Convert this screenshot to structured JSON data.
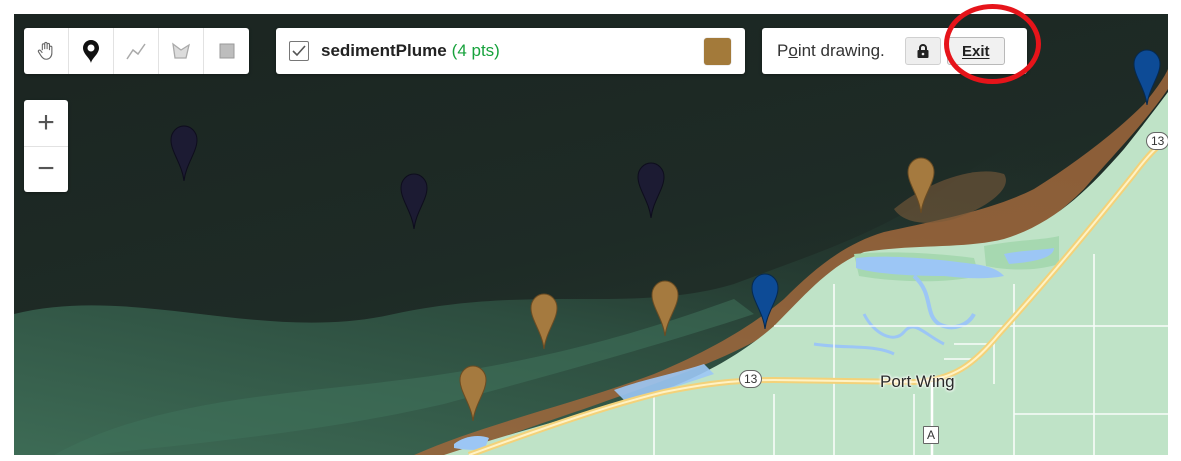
{
  "toolbar": {
    "tools": [
      {
        "name": "pan-hand-icon"
      },
      {
        "name": "point-marker-icon"
      },
      {
        "name": "line-tool-icon"
      },
      {
        "name": "polygon-tool-icon"
      },
      {
        "name": "rectangle-tool-icon"
      }
    ]
  },
  "layer": {
    "checked": true,
    "name": "sedimentPlume",
    "count": "(4 pts)",
    "color": "#a37a3a"
  },
  "point_drawing": {
    "label_pre": "P",
    "label_u": "o",
    "label_post": "int drawing.",
    "exit_u": "E",
    "exit_rest": "xit"
  },
  "zoom": {
    "in": "+",
    "out": "−"
  },
  "map": {
    "place_label": "Port Wing",
    "route_13": "13",
    "route_a": "A",
    "colors": {
      "sediment_marker": "#a57a3f",
      "water_marker": "#0d4b96",
      "dark_marker": "#1c1b33"
    }
  }
}
